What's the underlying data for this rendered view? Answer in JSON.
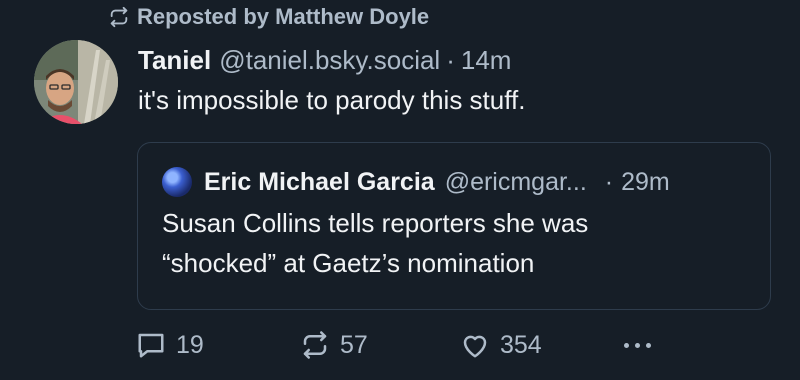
{
  "repost": {
    "label": "Reposted by Matthew Doyle",
    "icon": "repost-icon"
  },
  "post": {
    "author_name": "Taniel",
    "handle": "@taniel.bsky.social",
    "separator": "·",
    "time": "14m",
    "text": "it's impossible to parody this stuff."
  },
  "quote": {
    "author_name": "Eric Michael Garcia",
    "handle": "@ericmgar...",
    "separator": "·",
    "time": "29m",
    "text_line1": "Susan Collins tells reporters she was",
    "text_line2": "“shocked” at Gaetz’s nomination"
  },
  "actions": {
    "reply_count": "19",
    "repost_count": "57",
    "like_count": "354"
  },
  "colors": {
    "background": "#161e27",
    "text_primary": "#f1f3f5",
    "text_secondary": "#aebbc9",
    "card_border": "#2e3c4c"
  }
}
